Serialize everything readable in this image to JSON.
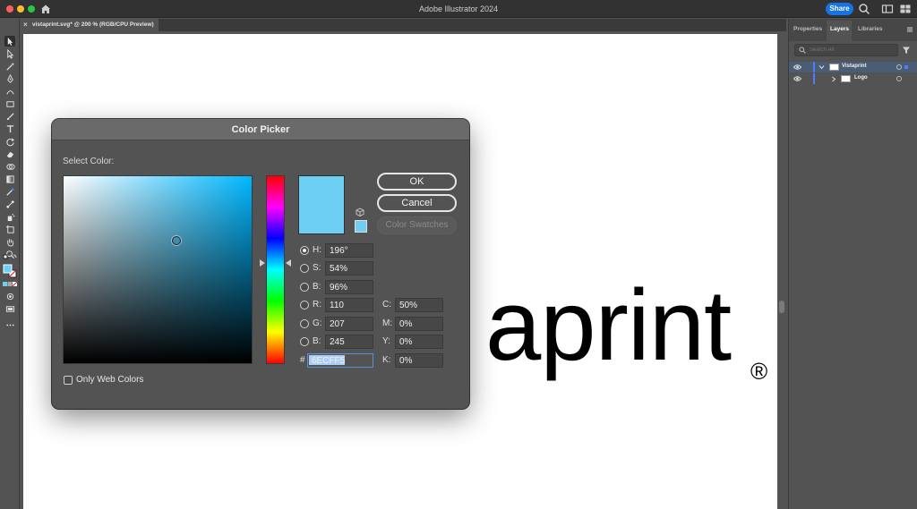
{
  "window": {
    "app_title": "Adobe Illustrator 2024",
    "share_label": "Share"
  },
  "document": {
    "tab_title": "vistaprint.svg* @ 200 % (RGB/CPU Preview)",
    "close_glyph": "×"
  },
  "artboard": {
    "logo_text": "aprint",
    "logo_mark": "®"
  },
  "panel": {
    "tabs": [
      "Properties",
      "Layers",
      "Libraries"
    ],
    "active_tab": "Layers",
    "search_placeholder": "Search All",
    "layers": [
      {
        "name": "Vistaprint",
        "selected": true
      },
      {
        "name": "Logo",
        "selected": false
      }
    ]
  },
  "dialog": {
    "title": "Color Picker",
    "select_label": "Select Color:",
    "ok_label": "OK",
    "cancel_label": "Cancel",
    "swatches_label": "Color Swatches",
    "web_colors_label": "Only Web Colors",
    "current_color": "#6ECFF5",
    "hue_base": "#00b7ff",
    "fields": {
      "H": {
        "label": "H:",
        "value": "196°"
      },
      "S": {
        "label": "S:",
        "value": "54%"
      },
      "B": {
        "label": "B:",
        "value": "96%"
      },
      "R": {
        "label": "R:",
        "value": "110"
      },
      "G": {
        "label": "G:",
        "value": "207"
      },
      "B2": {
        "label": "B:",
        "value": "245"
      },
      "C": {
        "label": "C:",
        "value": "50%"
      },
      "M": {
        "label": "M:",
        "value": "0%"
      },
      "Y": {
        "label": "Y:",
        "value": "0%"
      },
      "K": {
        "label": "K:",
        "value": "0%"
      }
    },
    "hex_label": "#",
    "hex_value": "6ECFF5"
  }
}
